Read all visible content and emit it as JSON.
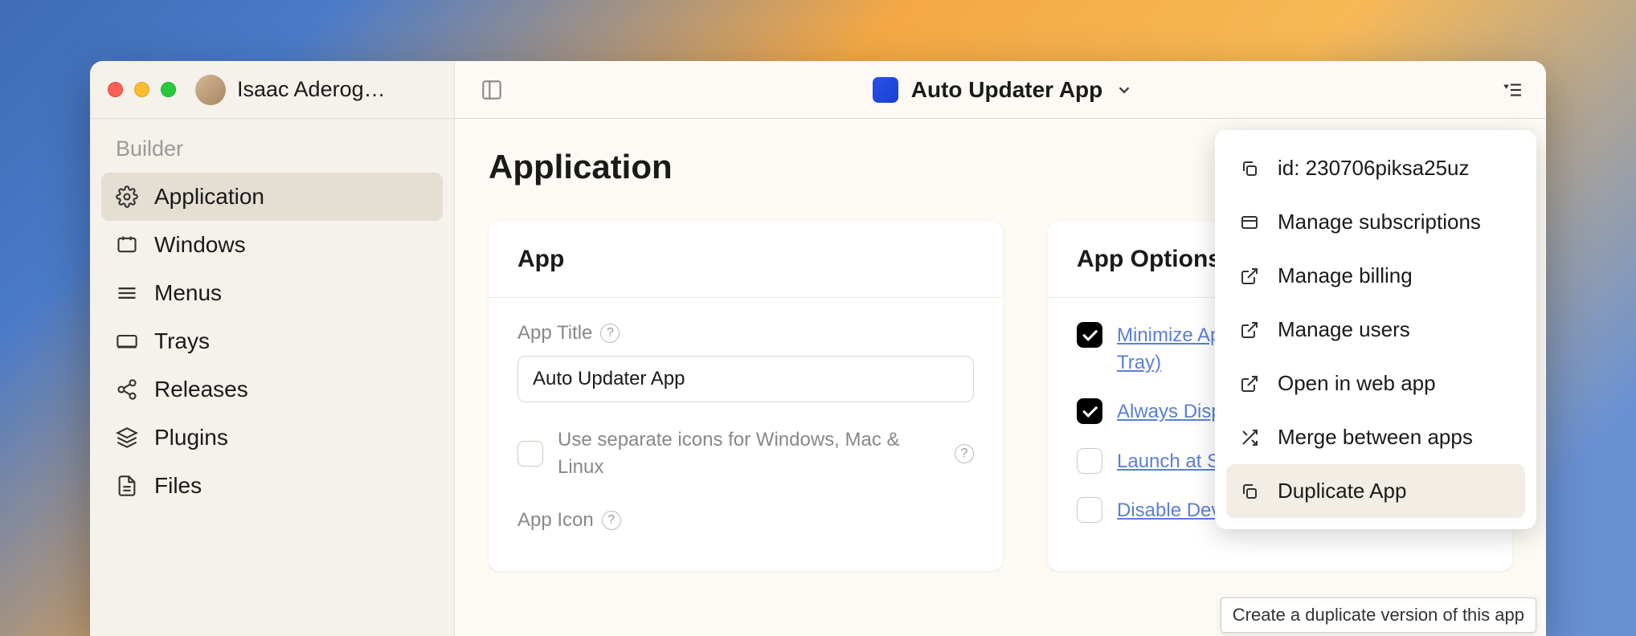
{
  "user": {
    "name": "Isaac Aderog…"
  },
  "app": {
    "name": "Auto Updater App"
  },
  "sidebar": {
    "section": "Builder",
    "items": [
      {
        "label": "Application",
        "icon": "gear",
        "active": true
      },
      {
        "label": "Windows",
        "icon": "windows",
        "active": false
      },
      {
        "label": "Menus",
        "icon": "menu",
        "active": false
      },
      {
        "label": "Trays",
        "icon": "tray",
        "active": false
      },
      {
        "label": "Releases",
        "icon": "share",
        "active": false
      },
      {
        "label": "Plugins",
        "icon": "layers",
        "active": false
      },
      {
        "label": "Files",
        "icon": "file",
        "active": false
      }
    ]
  },
  "page": {
    "title": "Application"
  },
  "card_app": {
    "title": "App",
    "field_title_label": "App Title",
    "field_title_value": "Auto Updater App",
    "separate_icons_label": "Use separate icons for Windows, Mac & Linux",
    "separate_icons_checked": false,
    "app_icon_label": "App Icon"
  },
  "card_options": {
    "title": "App Options",
    "options": [
      {
        "label": "Minimize Ap",
        "label2": "Tray)",
        "checked": true
      },
      {
        "label": "Always Disp",
        "checked": true
      },
      {
        "label": "Launch at S",
        "checked": false
      },
      {
        "label": "Disable Dev Tools",
        "checked": false
      }
    ]
  },
  "menu": {
    "items": [
      {
        "label": "id: 230706piksa25uz",
        "icon": "copy"
      },
      {
        "label": "Manage subscriptions",
        "icon": "card"
      },
      {
        "label": "Manage billing",
        "icon": "external"
      },
      {
        "label": "Manage users",
        "icon": "external"
      },
      {
        "label": "Open in web app",
        "icon": "external"
      },
      {
        "label": "Merge between apps",
        "icon": "shuffle"
      },
      {
        "label": "Duplicate App",
        "icon": "copy"
      }
    ]
  },
  "tooltip": "Create a duplicate version of this app"
}
